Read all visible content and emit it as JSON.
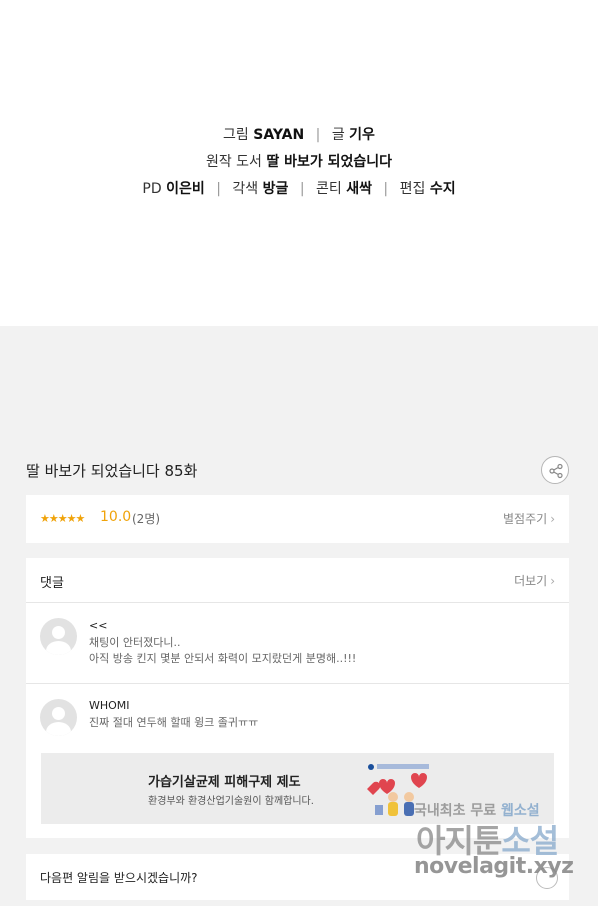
{
  "credits": {
    "line1": {
      "k1": "그림",
      "v1": "SAYAN",
      "k2": "글",
      "v2": "기우"
    },
    "line2": {
      "k1": "원작 도서",
      "v1": "딸 바보가 되었습니다"
    },
    "line3": {
      "k1": "PD",
      "v1": "이은비",
      "k2": "각색",
      "v2": "방글",
      "k3": "콘티",
      "v3": "새싹",
      "k4": "편집",
      "v4": "수지"
    },
    "separator": "|"
  },
  "episode": {
    "title": "딸 바보가 되었습니다 85화",
    "share_icon": "share-icon"
  },
  "rating": {
    "stars": "★★★★★",
    "score": "10.0",
    "count": "(2명)",
    "rate_label": "별점주기",
    "chevron": "›"
  },
  "comments": {
    "title": "댓글",
    "more_label": "더보기",
    "chevron": "›",
    "items": [
      {
        "nickname": "<<",
        "lines": [
          "채팅이 안터졌다니..",
          "아직 방송 킨지 몇분 안되서 화력이 모지랐던게 분명해..!!!"
        ]
      },
      {
        "nickname": "WHOMI",
        "lines": [
          "진짜 절대 연두해 할때 윙크 졸귀ㅠㅠ"
        ]
      }
    ]
  },
  "ad": {
    "title": "가습기살균제 피해구제 제도",
    "subtitle": "환경부와 환경산업기술원이 함께합니다."
  },
  "notify": {
    "question": "다음편 알림을 받으시겠습니까?"
  },
  "watermark": {
    "top_a": "국내최초 무료 ",
    "top_b": "웹소설",
    "mid_a": "아지툰",
    "mid_b": "소설",
    "domain": "novelagit.xyz"
  },
  "colors": {
    "accent": "#f0a30a",
    "page_bg": "#f2f2f2",
    "card_bg": "#ffffff"
  }
}
